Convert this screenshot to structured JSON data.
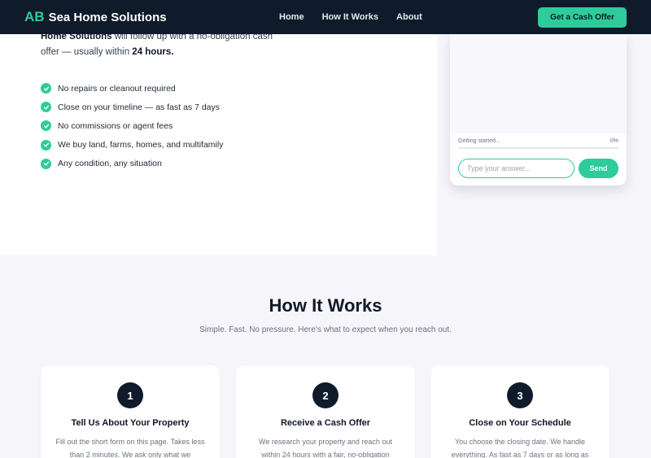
{
  "nav": {
    "brand_prefix": "AB",
    "brand_name": "Sea Home Solutions",
    "links": [
      "Home",
      "How It Works",
      "About"
    ],
    "cta": "Get a Cash Offer"
  },
  "hero": {
    "intro_bold": "Home Solutions",
    "intro_text": " will follow up with a no-obligation cash offer — usually within ",
    "intro_emph": "24 hours.",
    "checks": [
      "No repairs or cleanout required",
      "Close on your timeline — as fast as 7 days",
      "No commissions or agent fees",
      "We buy land, farms, homes, and multifamily",
      "Any condition, any situation"
    ]
  },
  "chat": {
    "status": "Getting started...",
    "progress_label": "0%",
    "progress": 0,
    "input_placeholder": "Type your answer...",
    "send_label": "Send"
  },
  "how": {
    "title": "How It Works",
    "subtitle": "Simple. Fast. No pressure. Here's what to expect when you reach out.",
    "steps": [
      {
        "num": "1",
        "title": "Tell Us About Your Property",
        "text": "Fill out the short form on this page. Takes less than 2 minutes. We ask only what we"
      },
      {
        "num": "2",
        "title": "Receive a Cash Offer",
        "text": "We research your property and reach out within 24 hours with a fair, no-obligation"
      },
      {
        "num": "3",
        "title": "Close on Your Schedule",
        "text": "You choose the closing date. We handle everything. As fast as 7 days or as long as"
      }
    ]
  },
  "colors": {
    "nav_bg": "#0f1b2a",
    "accent": "#2ecc9a",
    "section_bg": "#f5f5fa"
  }
}
